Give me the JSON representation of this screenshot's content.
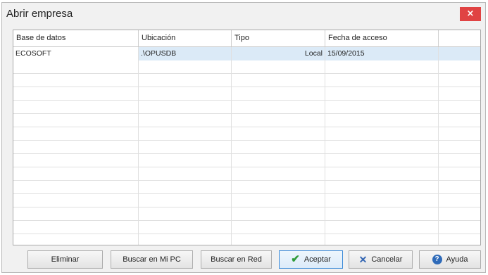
{
  "window": {
    "title": "Abrir empresa",
    "close_label": "×"
  },
  "grid": {
    "columns": [
      "Base de datos",
      "Ubicación",
      "Tipo",
      "Fecha de acceso",
      ""
    ],
    "rows": [
      [
        "ECOSOFT",
        ".\\OPUSDB",
        "Local",
        "15/09/2015",
        ""
      ]
    ],
    "empty_rows": 14
  },
  "buttons": {
    "eliminar": "Eliminar",
    "buscar_pc": "Buscar en Mi PC",
    "buscar_red": "Buscar en Red",
    "aceptar": "Aceptar",
    "cancelar": "Cancelar",
    "ayuda": "Ayuda"
  },
  "icons": {
    "aceptar": "check-icon",
    "cancelar": "x-icon",
    "ayuda": "help-icon"
  },
  "colors": {
    "close_button": "#e04343",
    "selection": "#dbeaf7",
    "accept_check": "#2f9c3a",
    "cancel_x": "#3567b3",
    "help": "#2f6bb9"
  }
}
